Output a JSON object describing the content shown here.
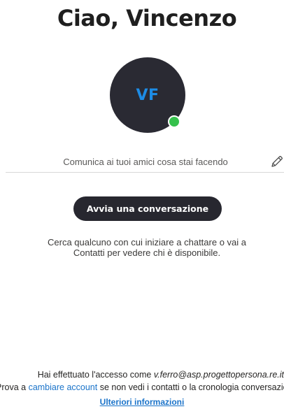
{
  "greeting": "Ciao, Vincenzo",
  "avatar": {
    "initials": "VF",
    "presence": "online",
    "presence_color": "#35c14c",
    "initials_color": "#1d8ce6",
    "background_color": "#2a2a33"
  },
  "status": {
    "placeholder": "Comunica ai tuoi amici cosa stai facendo",
    "value": "",
    "edit_icon": "pencil-icon"
  },
  "start_button": {
    "label": "Avvia una conversazione"
  },
  "helper": {
    "line1": "Cerca qualcuno con cui iniziare a chattare o vai a",
    "line2": "Contatti per vedere chi è disponibile."
  },
  "footer": {
    "signed_in_prefix": "Hai effettuato l'accesso come ",
    "account_email": "v.ferro@asp.progettopersona.re.it",
    "switch_prefix": "Prova a ",
    "switch_link": "cambiare account",
    "switch_suffix": " se non vedi i contatti o la cronologia conversazioni.",
    "more_info": "Ulteriori informazioni"
  },
  "colors": {
    "link": "#1a73c9",
    "button_bg": "#27272f"
  }
}
